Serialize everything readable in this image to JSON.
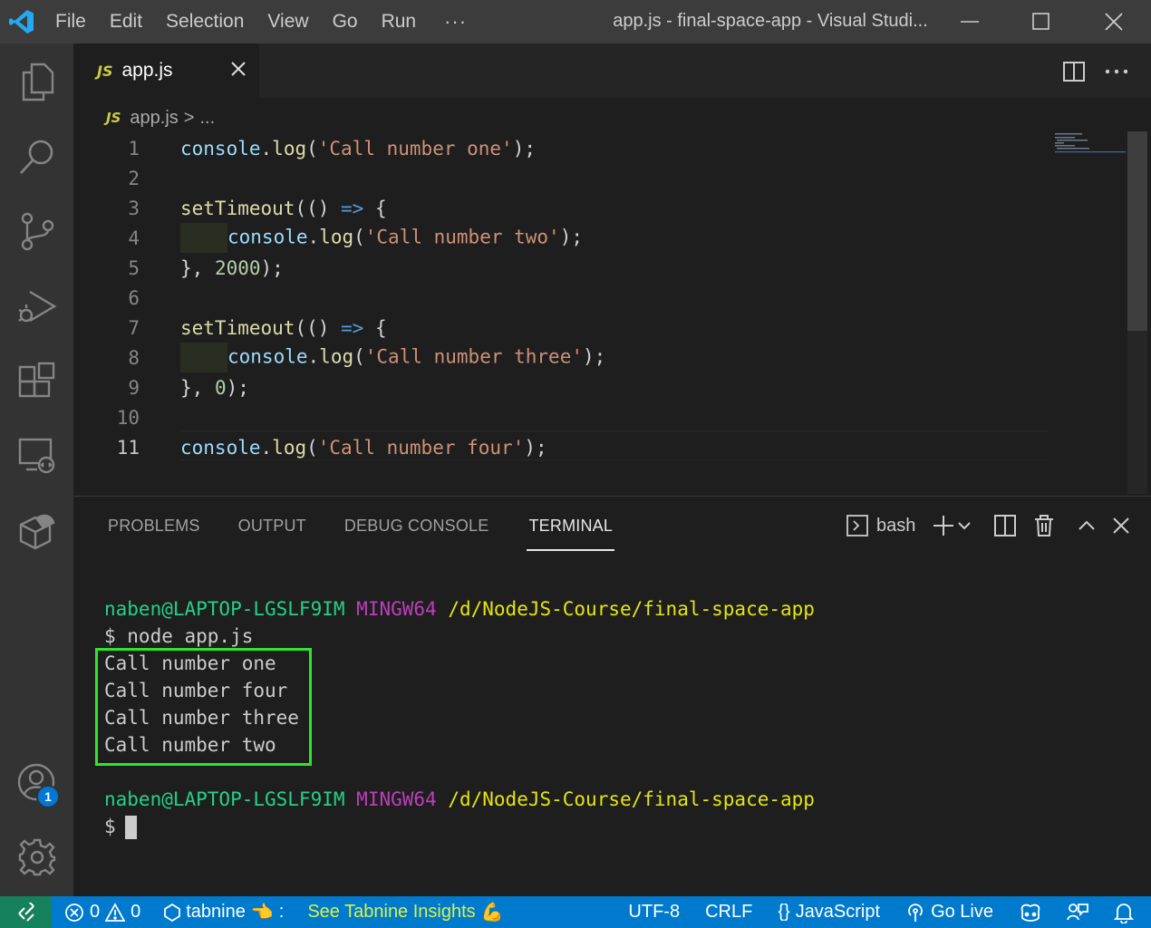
{
  "titlebar": {
    "menu": [
      "File",
      "Edit",
      "Selection",
      "View",
      "Go",
      "Run"
    ],
    "more": "···",
    "window_title": "app.js - final-space-app - Visual Studi..."
  },
  "activity": {
    "accounts_badge": "1"
  },
  "editor": {
    "tab_icon": "JS",
    "tab_label": "app.js",
    "breadcrumb": {
      "icon": "JS",
      "file": "app.js",
      "sep": ">",
      "rest": "..."
    },
    "lines": [
      {
        "n": "1"
      },
      {
        "n": "2"
      },
      {
        "n": "3"
      },
      {
        "n": "4"
      },
      {
        "n": "5"
      },
      {
        "n": "6"
      },
      {
        "n": "7"
      },
      {
        "n": "8"
      },
      {
        "n": "9"
      },
      {
        "n": "10"
      },
      {
        "n": "11"
      }
    ],
    "code": {
      "l1": [
        "console",
        ".",
        "log",
        "(",
        "'Call number one'",
        ");"
      ],
      "l3": [
        "setTimeout",
        "(() ",
        "=>",
        " {"
      ],
      "l4": [
        "console",
        ".",
        "log",
        "(",
        "'Call number two'",
        ");"
      ],
      "l5": [
        "}, ",
        "2000",
        ");"
      ],
      "l7": [
        "setTimeout",
        "(() ",
        "=>",
        " {"
      ],
      "l8": [
        "console",
        ".",
        "log",
        "(",
        "'Call number three'",
        ");"
      ],
      "l9": [
        "}, ",
        "0",
        ");"
      ],
      "l11": [
        "console",
        ".",
        "log",
        "(",
        "'Call number four'",
        ");"
      ]
    }
  },
  "panel": {
    "tabs": [
      "PROBLEMS",
      "OUTPUT",
      "DEBUG CONSOLE",
      "TERMINAL"
    ],
    "active_tab": "TERMINAL",
    "shell": "bash"
  },
  "terminal": {
    "prompt1": {
      "user": "naben@LAPTOP-LGSLF9IM",
      "host": "MINGW64",
      "path": "/d/NodeJS-Course/final-space-app"
    },
    "command": "$ node app.js",
    "output": [
      "Call number one",
      "Call number four",
      "Call number three",
      "Call number two"
    ],
    "prompt2": {
      "user": "naben@LAPTOP-LGSLF9IM",
      "host": "MINGW64",
      "path": "/d/NodeJS-Course/final-space-app"
    },
    "dollar": "$"
  },
  "statusbar": {
    "errors": "0",
    "warnings": "0",
    "tabnine": "tabnine",
    "tabnine_suffix": ":",
    "insights": "See Tabnine Insights",
    "encoding": "UTF-8",
    "eol": "CRLF",
    "language_icon": "{}",
    "language": "JavaScript",
    "golive": "Go Live"
  },
  "colors": {
    "titlebar": "#3c3c3c",
    "activitybar": "#333333",
    "editor_bg": "#1e1e1e",
    "statusbar": "#007acc",
    "remote": "#16825d",
    "highlight_box": "#2ee62e",
    "string": "#ce9178",
    "function": "#dcdcaa",
    "object": "#9cdcfe"
  }
}
